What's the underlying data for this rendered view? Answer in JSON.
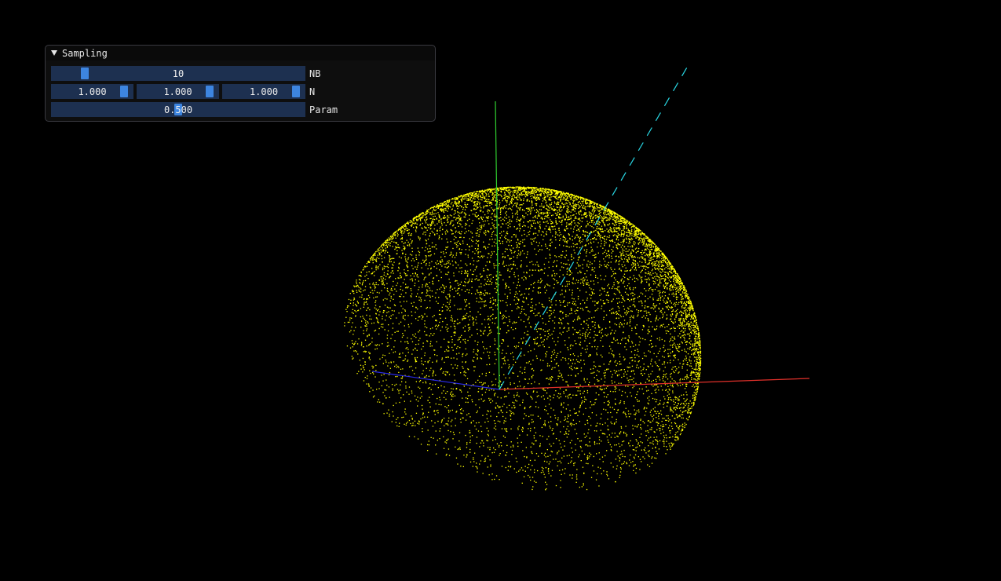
{
  "window": {
    "title": "Sampling",
    "collapse_icon": "triangle-down-icon"
  },
  "controls": {
    "nb": {
      "value_text": "10",
      "label": "NB",
      "fraction": 0.115
    },
    "n": {
      "label": "N",
      "components": [
        {
          "value_text": "1.000",
          "fraction": 0.95
        },
        {
          "value_text": "1.000",
          "fraction": 0.95
        },
        {
          "value_text": "1.000",
          "fraction": 0.95
        }
      ]
    },
    "param": {
      "value_text": "0.500",
      "label": "Param",
      "fraction": 0.5
    }
  },
  "scene": {
    "background": "#000000",
    "point_color": "#ffff00",
    "axis_x_color": "#e0302a",
    "axis_y_color": "#30d030",
    "axis_z_color": "#2a2ae6",
    "direction_color": "#29d9e6",
    "direction_style": "dashed"
  }
}
